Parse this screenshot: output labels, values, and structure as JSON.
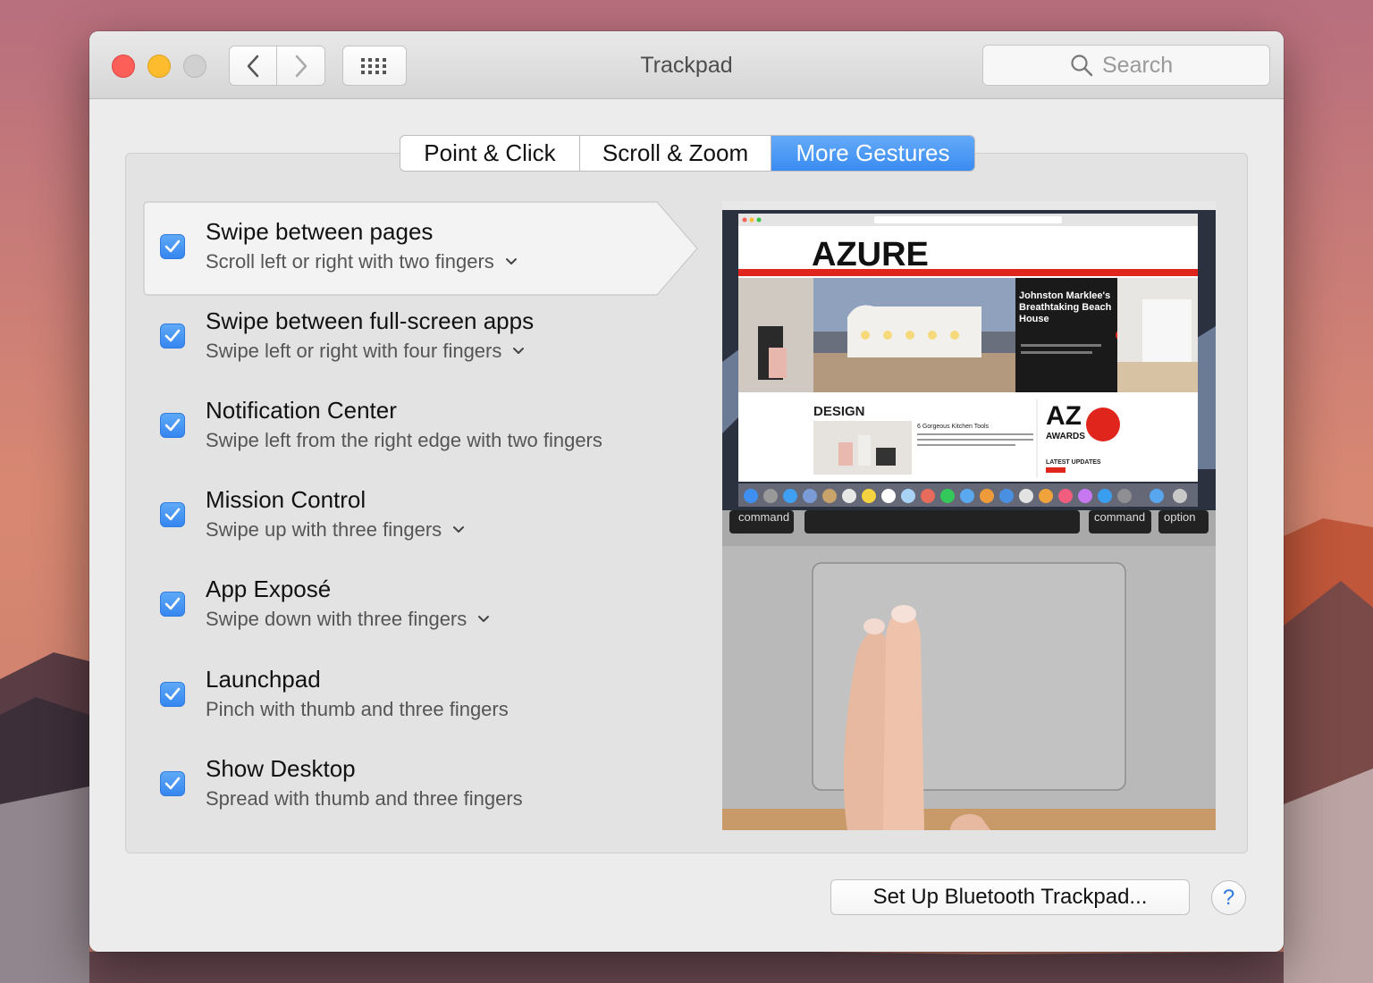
{
  "window": {
    "title": "Trackpad",
    "search_placeholder": "Search"
  },
  "tabs": [
    {
      "label": "Point & Click",
      "active": false
    },
    {
      "label": "Scroll & Zoom",
      "active": false
    },
    {
      "label": "More Gestures",
      "active": true
    }
  ],
  "gestures": [
    {
      "title": "Swipe between pages",
      "description": "Scroll left or right with two fingers",
      "checked": true,
      "has_options": true,
      "selected": true
    },
    {
      "title": "Swipe between full-screen apps",
      "description": "Swipe left or right with four fingers",
      "checked": true,
      "has_options": true,
      "selected": false
    },
    {
      "title": "Notification Center",
      "description": "Swipe left from the right edge with two fingers",
      "checked": true,
      "has_options": false,
      "selected": false
    },
    {
      "title": "Mission Control",
      "description": "Swipe up with three fingers",
      "checked": true,
      "has_options": true,
      "selected": false
    },
    {
      "title": "App Exposé",
      "description": "Swipe down with three fingers",
      "checked": true,
      "has_options": true,
      "selected": false
    },
    {
      "title": "Launchpad",
      "description": "Pinch with thumb and three fingers",
      "checked": true,
      "has_options": false,
      "selected": false
    },
    {
      "title": "Show Desktop",
      "description": "Spread with thumb and three fingers",
      "checked": true,
      "has_options": false,
      "selected": false
    }
  ],
  "preview": {
    "site_logo": "AZURE",
    "headline": "Johnston Marklee's Breathtaking Beach House",
    "section_label": "DESIGN",
    "article_title": "6 Gorgeous Kitchen Tools",
    "awards_logo_top": "AZ",
    "awards_logo_bottom": "AWARDS",
    "latest_updates": "LATEST UPDATES",
    "key_command_left": "command",
    "key_command_right": "command",
    "key_option": "option"
  },
  "footer": {
    "bluetooth_button": "Set Up Bluetooth Trackpad...",
    "help_button": "?"
  },
  "colors": {
    "accent": "#3a8cf2",
    "checkbox": "#3586f0",
    "azure_red": "#e0261c"
  }
}
